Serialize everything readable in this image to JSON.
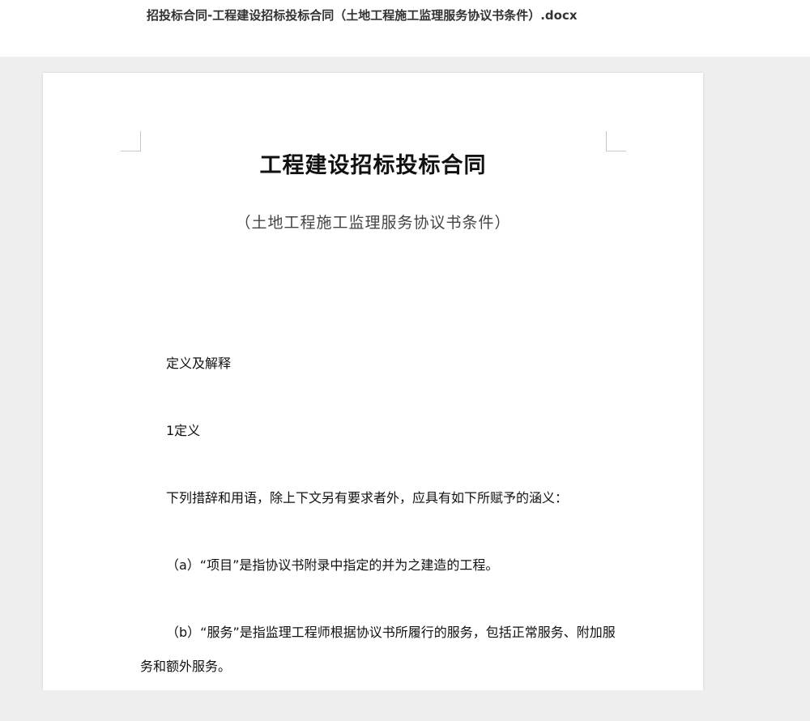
{
  "window": {
    "filename": "招投标合同-工程建设招标投标合同（土地工程施工监理服务协议书条件）.docx"
  },
  "document": {
    "title": "工程建设招标投标合同",
    "subtitle": "（土地工程施工监理服务协议书条件）",
    "paragraphs": [
      "定义及解释",
      "1定义",
      "下列措辞和用语，除上下文另有要求者外，应具有如下所赋予的涵义：",
      "（a）“项目”是指协议书附录中指定的并为之建造的工程。",
      "（b）“服务”是指监理工程师根据协议书所履行的服务，包括正常服务、附加服",
      "务和额外服务。"
    ]
  }
}
